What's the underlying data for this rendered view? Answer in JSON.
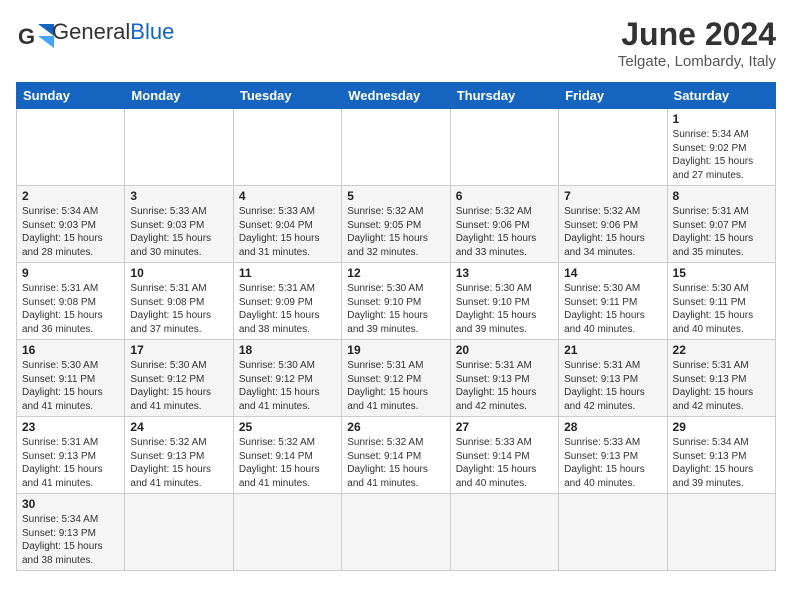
{
  "header": {
    "logo_text_normal": "General",
    "logo_text_blue": "Blue",
    "title": "June 2024",
    "subtitle": "Telgate, Lombardy, Italy"
  },
  "calendar": {
    "days_of_week": [
      "Sunday",
      "Monday",
      "Tuesday",
      "Wednesday",
      "Thursday",
      "Friday",
      "Saturday"
    ],
    "weeks": [
      [
        {
          "day": "",
          "info": ""
        },
        {
          "day": "",
          "info": ""
        },
        {
          "day": "",
          "info": ""
        },
        {
          "day": "",
          "info": ""
        },
        {
          "day": "",
          "info": ""
        },
        {
          "day": "",
          "info": ""
        },
        {
          "day": "1",
          "info": "Sunrise: 5:34 AM\nSunset: 9:02 PM\nDaylight: 15 hours\nand 27 minutes."
        }
      ],
      [
        {
          "day": "2",
          "info": "Sunrise: 5:34 AM\nSunset: 9:03 PM\nDaylight: 15 hours\nand 28 minutes."
        },
        {
          "day": "3",
          "info": "Sunrise: 5:33 AM\nSunset: 9:03 PM\nDaylight: 15 hours\nand 30 minutes."
        },
        {
          "day": "4",
          "info": "Sunrise: 5:33 AM\nSunset: 9:04 PM\nDaylight: 15 hours\nand 31 minutes."
        },
        {
          "day": "5",
          "info": "Sunrise: 5:32 AM\nSunset: 9:05 PM\nDaylight: 15 hours\nand 32 minutes."
        },
        {
          "day": "6",
          "info": "Sunrise: 5:32 AM\nSunset: 9:06 PM\nDaylight: 15 hours\nand 33 minutes."
        },
        {
          "day": "7",
          "info": "Sunrise: 5:32 AM\nSunset: 9:06 PM\nDaylight: 15 hours\nand 34 minutes."
        },
        {
          "day": "8",
          "info": "Sunrise: 5:31 AM\nSunset: 9:07 PM\nDaylight: 15 hours\nand 35 minutes."
        }
      ],
      [
        {
          "day": "9",
          "info": "Sunrise: 5:31 AM\nSunset: 9:08 PM\nDaylight: 15 hours\nand 36 minutes."
        },
        {
          "day": "10",
          "info": "Sunrise: 5:31 AM\nSunset: 9:08 PM\nDaylight: 15 hours\nand 37 minutes."
        },
        {
          "day": "11",
          "info": "Sunrise: 5:31 AM\nSunset: 9:09 PM\nDaylight: 15 hours\nand 38 minutes."
        },
        {
          "day": "12",
          "info": "Sunrise: 5:30 AM\nSunset: 9:10 PM\nDaylight: 15 hours\nand 39 minutes."
        },
        {
          "day": "13",
          "info": "Sunrise: 5:30 AM\nSunset: 9:10 PM\nDaylight: 15 hours\nand 39 minutes."
        },
        {
          "day": "14",
          "info": "Sunrise: 5:30 AM\nSunset: 9:11 PM\nDaylight: 15 hours\nand 40 minutes."
        },
        {
          "day": "15",
          "info": "Sunrise: 5:30 AM\nSunset: 9:11 PM\nDaylight: 15 hours\nand 40 minutes."
        }
      ],
      [
        {
          "day": "16",
          "info": "Sunrise: 5:30 AM\nSunset: 9:11 PM\nDaylight: 15 hours\nand 41 minutes."
        },
        {
          "day": "17",
          "info": "Sunrise: 5:30 AM\nSunset: 9:12 PM\nDaylight: 15 hours\nand 41 minutes."
        },
        {
          "day": "18",
          "info": "Sunrise: 5:30 AM\nSunset: 9:12 PM\nDaylight: 15 hours\nand 41 minutes."
        },
        {
          "day": "19",
          "info": "Sunrise: 5:31 AM\nSunset: 9:12 PM\nDaylight: 15 hours\nand 41 minutes."
        },
        {
          "day": "20",
          "info": "Sunrise: 5:31 AM\nSunset: 9:13 PM\nDaylight: 15 hours\nand 42 minutes."
        },
        {
          "day": "21",
          "info": "Sunrise: 5:31 AM\nSunset: 9:13 PM\nDaylight: 15 hours\nand 42 minutes."
        },
        {
          "day": "22",
          "info": "Sunrise: 5:31 AM\nSunset: 9:13 PM\nDaylight: 15 hours\nand 42 minutes."
        }
      ],
      [
        {
          "day": "23",
          "info": "Sunrise: 5:31 AM\nSunset: 9:13 PM\nDaylight: 15 hours\nand 41 minutes."
        },
        {
          "day": "24",
          "info": "Sunrise: 5:32 AM\nSunset: 9:13 PM\nDaylight: 15 hours\nand 41 minutes."
        },
        {
          "day": "25",
          "info": "Sunrise: 5:32 AM\nSunset: 9:14 PM\nDaylight: 15 hours\nand 41 minutes."
        },
        {
          "day": "26",
          "info": "Sunrise: 5:32 AM\nSunset: 9:14 PM\nDaylight: 15 hours\nand 41 minutes."
        },
        {
          "day": "27",
          "info": "Sunrise: 5:33 AM\nSunset: 9:14 PM\nDaylight: 15 hours\nand 40 minutes."
        },
        {
          "day": "28",
          "info": "Sunrise: 5:33 AM\nSunset: 9:13 PM\nDaylight: 15 hours\nand 40 minutes."
        },
        {
          "day": "29",
          "info": "Sunrise: 5:34 AM\nSunset: 9:13 PM\nDaylight: 15 hours\nand 39 minutes."
        }
      ],
      [
        {
          "day": "30",
          "info": "Sunrise: 5:34 AM\nSunset: 9:13 PM\nDaylight: 15 hours\nand 38 minutes."
        },
        {
          "day": "",
          "info": ""
        },
        {
          "day": "",
          "info": ""
        },
        {
          "day": "",
          "info": ""
        },
        {
          "day": "",
          "info": ""
        },
        {
          "day": "",
          "info": ""
        },
        {
          "day": "",
          "info": ""
        }
      ]
    ]
  }
}
